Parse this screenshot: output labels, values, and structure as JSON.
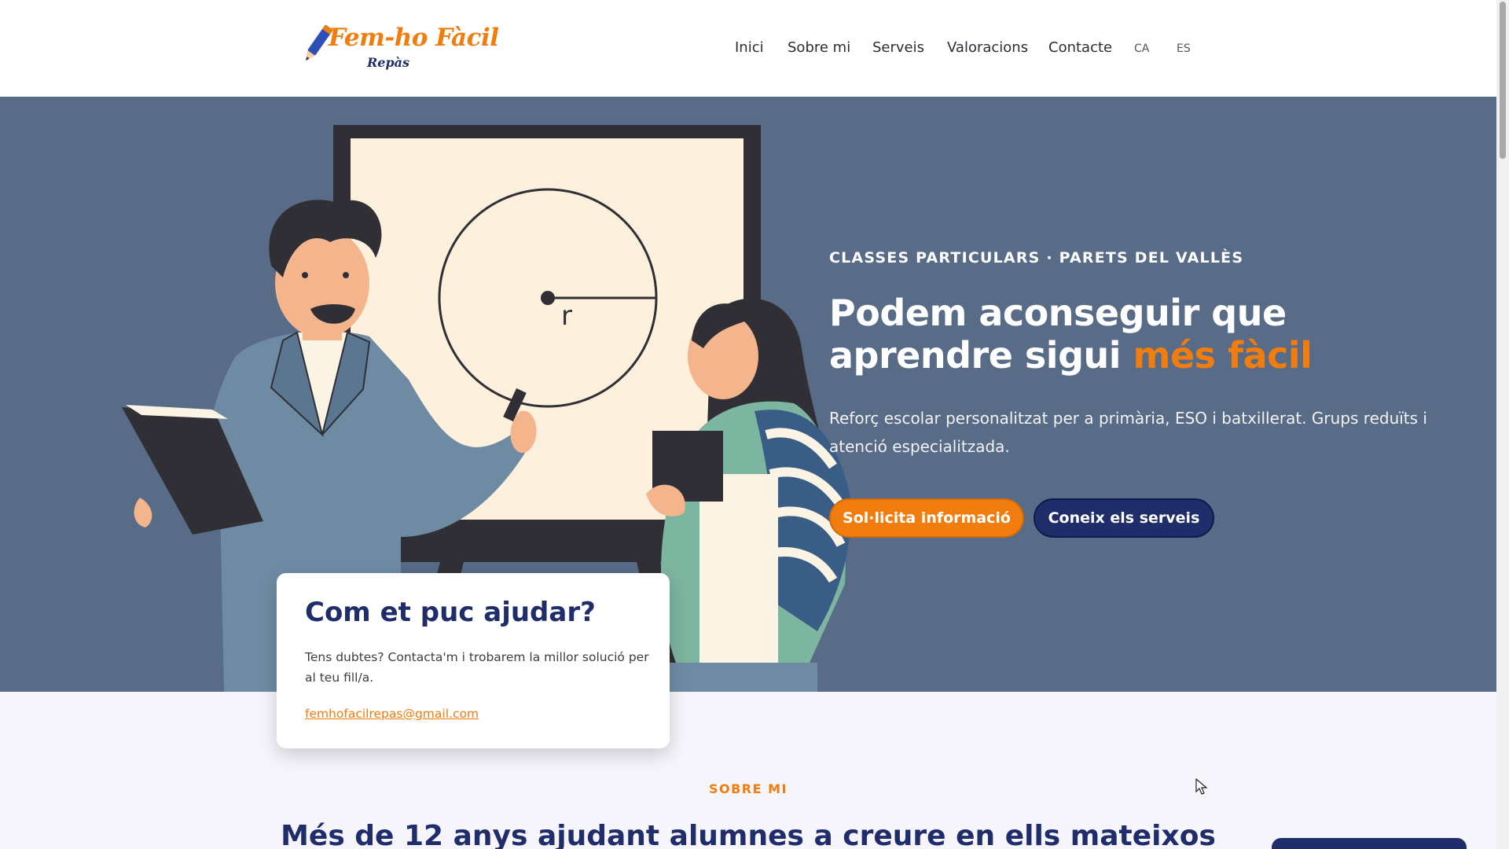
{
  "brand": {
    "name": "Fem-ho Fàcil",
    "sub": "Repàs",
    "colors": {
      "accent": "#f07d0e",
      "navy": "#1f2d6b",
      "hero_bg": "#586b87"
    }
  },
  "nav": {
    "items": [
      "Inici",
      "Sobre mi",
      "Serveis",
      "Valoracions",
      "Contacte"
    ],
    "languages": [
      "CA",
      "ES"
    ]
  },
  "hero": {
    "eyebrow": "CLASSES PARTICULARS · PARETS DEL VALLÈS",
    "headline_main": "Podem aconseguir que aprendre sigui ",
    "headline_accent": "més fàcil",
    "lead": "Reforç escolar personalitzat per a primària, ESO i batxillerat. Grups reduïts i atenció especialitzada.",
    "primary_cta": "Sol·licita informació",
    "secondary_cta": "Coneix els serveis",
    "whiteboard_label": "r"
  },
  "help_card": {
    "title": "Com et puc ajudar?",
    "text": "Tens dubtes? Contacta'm i trobarem la millor solució per al teu fill/a.",
    "email": "femhofacilrepas@gmail.com"
  },
  "about": {
    "eyebrow": "SOBRE MI",
    "title": "Més de 12 anys ajudant alumnes a creure en ells mateixos"
  },
  "icons": {
    "logo": "pencil-icon",
    "cursor": "mouse-cursor-icon"
  }
}
